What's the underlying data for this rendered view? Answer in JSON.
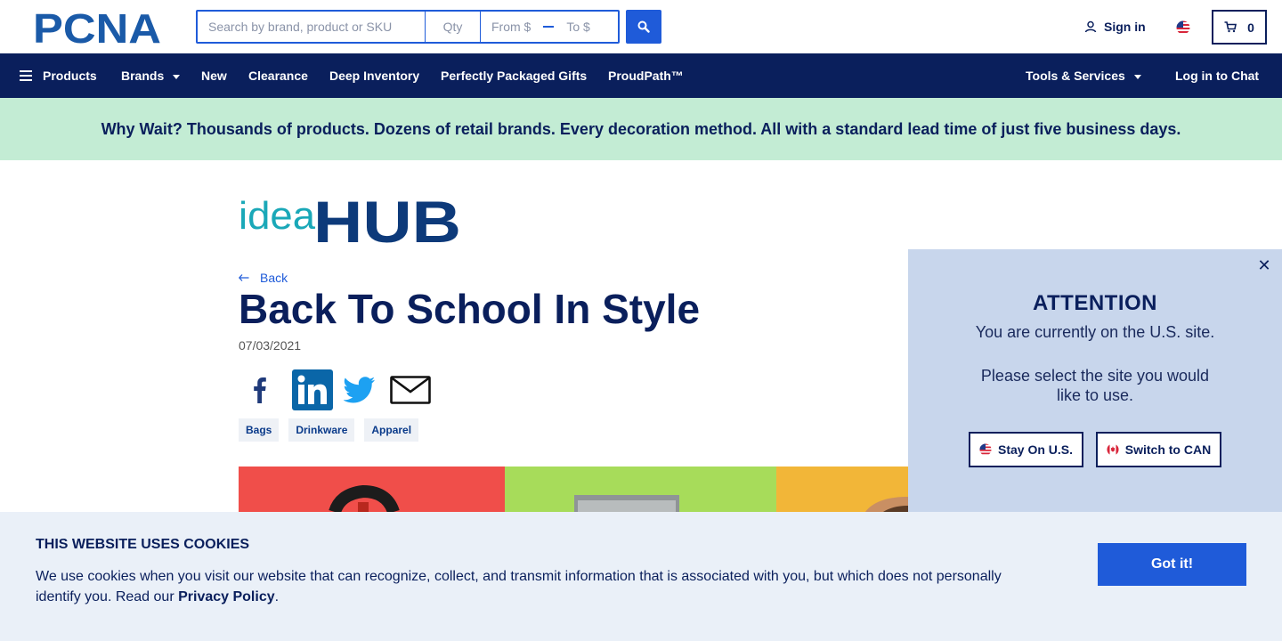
{
  "header": {
    "logo_text": "PCNA",
    "search": {
      "placeholder": "Search by brand, product or SKU",
      "qty_placeholder": "Qty",
      "from_placeholder": "From $",
      "to_placeholder": "To $"
    },
    "signin_label": "Sign in",
    "cart_count": "0"
  },
  "nav": {
    "products": "Products",
    "brands": "Brands",
    "new": "New",
    "clearance": "Clearance",
    "deep_inventory": "Deep Inventory",
    "gifts": "Perfectly Packaged Gifts",
    "proudpath": "ProudPath™",
    "tools": "Tools & Services",
    "chat": "Log in to Chat"
  },
  "banner": {
    "text": "Why Wait? Thousands of products. Dozens of retail brands. Every decoration method. All with a standard lead time of just five business days."
  },
  "article": {
    "brand_idea": "idea",
    "brand_hub": "HUB",
    "back_label": "Back",
    "title": "Back To School In Style",
    "date": "07/03/2021",
    "tags": [
      "Bags",
      "Drinkware",
      "Apparel"
    ]
  },
  "modal": {
    "title": "ATTENTION",
    "line1": "You are currently on the U.S. site.",
    "line2": "Please select the site you would",
    "line3": "like to use.",
    "stay_label": "Stay On U.S.",
    "switch_label": "Switch to CAN",
    "close_symbol": "✕"
  },
  "cookie": {
    "title": "THIS WEBSITE USES COOKIES",
    "text": "We use cookies when you visit our website that can recognize, collect, and transmit information that is associated with you, but which does not personally identify you. Read our ",
    "link": "Privacy Policy",
    "suffix": ".",
    "button": "Got it!"
  },
  "colors": {
    "navy": "#0a1f5c",
    "blue": "#1f5bd9",
    "teal": "#1aa8b8",
    "banner_bg": "#c3ecd4",
    "modal_bg": "#c8d6ec",
    "cookie_bg": "#eaf0f8"
  }
}
